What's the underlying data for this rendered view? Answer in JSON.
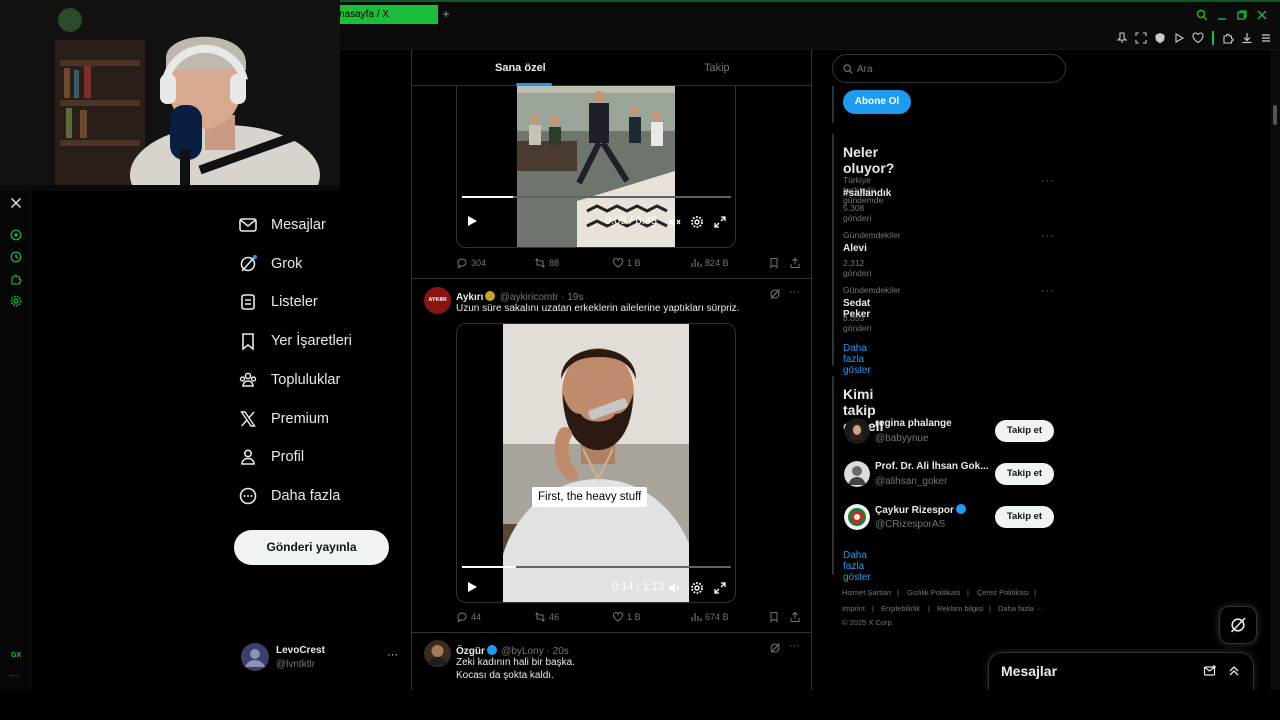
{
  "browser": {
    "tab_title": "nasayfa / X",
    "new_tab": "+"
  },
  "gx_sidebar": {
    "gx_label": "GX",
    "more": "···"
  },
  "nav": {
    "items": [
      {
        "label": "Mesajlar",
        "icon": "envelope-icon"
      },
      {
        "label": "Grok",
        "icon": "grok-icon"
      },
      {
        "label": "Listeler",
        "icon": "list-icon"
      },
      {
        "label": "Yer İşaretleri",
        "icon": "bookmark-icon"
      },
      {
        "label": "Topluluklar",
        "icon": "communities-icon"
      },
      {
        "label": "Premium",
        "icon": "x-logo-icon"
      },
      {
        "label": "Profil",
        "icon": "person-icon"
      },
      {
        "label": "Daha fazla",
        "icon": "more-circle-icon"
      }
    ],
    "post_button": "Gönderi yayınla",
    "account": {
      "name": "LevoCrest",
      "handle": "@lvntktlr",
      "more": "···"
    }
  },
  "timeline": {
    "tabs": [
      "Sana özel",
      "Takip"
    ],
    "active_tab": "Sana özel",
    "tweet1": {
      "video_time": "0:09 / 0:45",
      "progress": 0.19,
      "replies": "304",
      "reposts": "88",
      "likes": "1 B",
      "views": "824 B"
    },
    "tweet2": {
      "avatar_text": "AYKIRI",
      "name": "Aykırı",
      "handle": "@aykiricomtr · 19s",
      "text": "Uzun süre sakalını uzatan erkeklerin ailelerine yaptıkları sürpriz.",
      "caption": "First, the heavy stuff",
      "video_time": "0:14 / 1:13",
      "progress": 0.2,
      "replies": "44",
      "reposts": "46",
      "likes": "1 B",
      "views": "674 B"
    },
    "tweet3": {
      "name": "Özgür",
      "handle": "@byLony · 20s",
      "text_line1": "Zeki kadının hali bir başka.",
      "text_line2": "Kocası da şokta kaldı."
    }
  },
  "right": {
    "search_placeholder": "Ara",
    "subscribe_button": "Abone Ol",
    "trends": {
      "title": "Neler oluyor?",
      "items": [
        {
          "meta": "Türkiye tarihinde gündemde",
          "name": "#sallandık",
          "count": "5.308 gönderi"
        },
        {
          "meta": "Gündemdekiler",
          "name": "Alevi",
          "count": "2.312 gönderi"
        },
        {
          "meta": "Gündemdekiler",
          "name": "Sedat Peker",
          "count": "8.055 gönderi"
        }
      ],
      "show_more": "Daha fazla göster"
    },
    "who_to_follow": {
      "title": "Kimi takip etmeli",
      "users": [
        {
          "name": "regina phalange",
          "handle": "@babyynue",
          "button": "Takip et"
        },
        {
          "name": "Prof. Dr. Ali İhsan Gok...",
          "handle": "@alihsan_goker",
          "button": "Takip et"
        },
        {
          "name": "Çaykur Rizespor",
          "handle": "@CRizesporAS",
          "button": "Takip et"
        }
      ],
      "show_more": "Daha fazla göster"
    },
    "footer": {
      "row1": [
        "Hizmet Şartları",
        "Gizlilik Politikası",
        "Çerez Politikası"
      ],
      "row2": [
        "Imprint",
        "Erişilebilirlik",
        "Reklam bilgisi",
        "Daha fazla ···"
      ],
      "copyright": "© 2025 X Corp."
    }
  },
  "messages_drawer": {
    "title": "Mesajlar"
  }
}
